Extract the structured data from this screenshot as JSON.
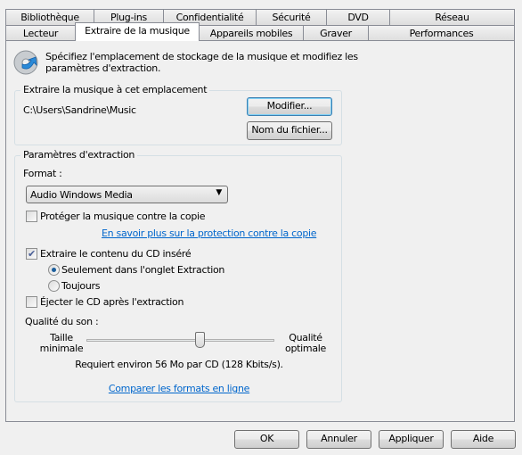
{
  "tabs_row1": [
    "Bibliothèque",
    "Plug-ins",
    "Confidentialité",
    "Sécurité",
    "DVD",
    "Réseau"
  ],
  "tabs_row2": [
    "Lecteur",
    "Extraire de la musique",
    "Appareils mobiles",
    "Graver",
    "Performances"
  ],
  "selected_tab": "Extraire de la musique",
  "intro": {
    "line1": "Spécifiez l'emplacement de stockage de la musique et modifiez les",
    "line2": "paramètres d'extraction.",
    "icon": "cd-rip-icon"
  },
  "location_group": {
    "label": "Extraire la musique à cet emplacement",
    "path": "C:\\Users\\Sandrine\\Music",
    "modify_button": "Modifier...",
    "filename_button": "Nom du fichier..."
  },
  "settings_group": {
    "label": "Paramètres d'extraction",
    "format_label": "Format :",
    "format_value": "Audio Windows Media",
    "protect_label": "Protéger la musique contre la copie",
    "protect_checked": false,
    "protect_link": "En savoir plus sur la protection contre la copie",
    "rip_cd_label": "Extraire le contenu du CD inséré",
    "rip_cd_checked": true,
    "radio_only": "Seulement dans l'onglet Extraction",
    "radio_always": "Toujours",
    "radio_selected": "only",
    "eject_label": "Éjecter le CD après l'extraction",
    "eject_checked": false,
    "quality_label": "Qualité du son :",
    "min_label_1": "Taille",
    "min_label_2": "minimale",
    "max_label_1": "Qualité",
    "max_label_2": "optimale",
    "quality_level": 0.6,
    "requirement": "Requiert environ 56 Mo par CD (128 Kbits/s).",
    "compare_link": "Comparer les formats en ligne"
  },
  "footer": {
    "ok": "OK",
    "cancel": "Annuler",
    "apply": "Appliquer",
    "help": "Aide"
  }
}
